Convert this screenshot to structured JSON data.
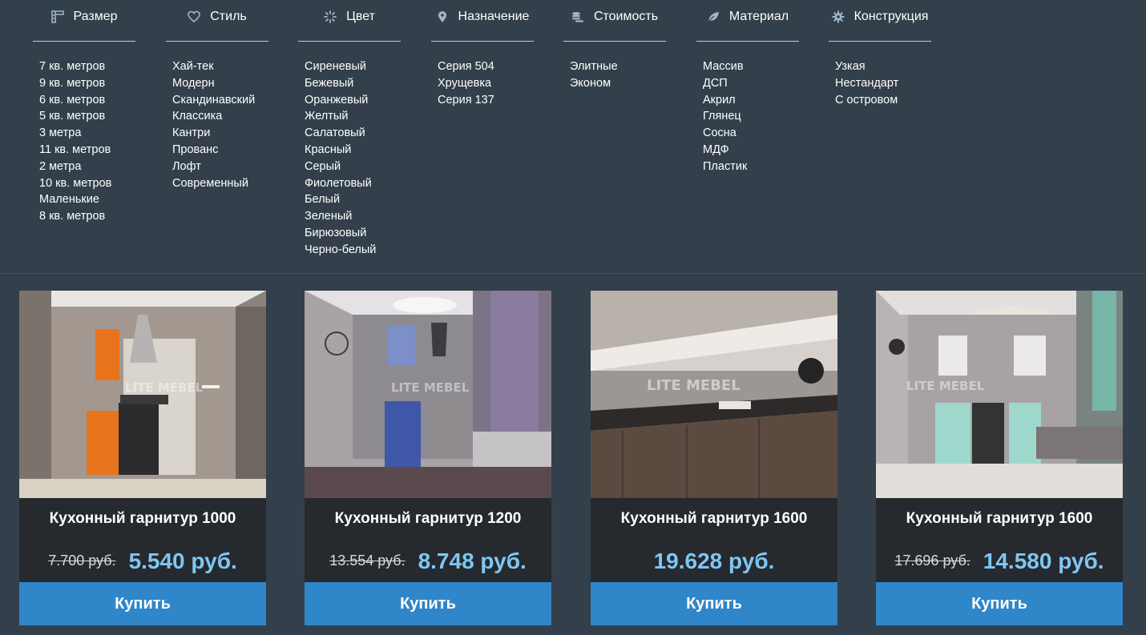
{
  "filters": [
    {
      "icon": "ruler-icon",
      "title": "Размер",
      "items": [
        "7 кв. метров",
        "9 кв. метров",
        "6 кв. метров",
        "5 кв. метров",
        "3 метра",
        "11 кв. метров",
        "2 метра",
        "10 кв. метров",
        "Маленькие",
        "8 кв. метров"
      ]
    },
    {
      "icon": "heart-icon",
      "title": "Стиль",
      "items": [
        "Хай-тек",
        "Модерн",
        "Скандинавский",
        "Классика",
        "Кантри",
        "Прованс",
        "Лофт",
        "Современный"
      ]
    },
    {
      "icon": "spinner-icon",
      "title": "Цвет",
      "items": [
        "Сиреневый",
        "Бежевый",
        "Оранжевый",
        "Желтый",
        "Салатовый",
        "Красный",
        "Серый",
        "Фиолетовый",
        "Белый",
        "Зеленый",
        "Бирюзовый",
        "Черно-белый"
      ]
    },
    {
      "icon": "map-marker-icon",
      "title": "Назначение",
      "items": [
        "Серия 504",
        "Хрущевка",
        "Серия 137"
      ]
    },
    {
      "icon": "coins-icon",
      "title": "Стоимость",
      "items": [
        "Элитные",
        "Эконом"
      ]
    },
    {
      "icon": "leaf-icon",
      "title": "Материал",
      "items": [
        "Массив",
        "ДСП",
        "Акрил",
        "Глянец",
        "Сосна",
        "МДФ",
        "Пластик"
      ]
    },
    {
      "icon": "gear-icon",
      "title": "Конструкция",
      "items": [
        "Узкая",
        "Нестандарт",
        "С островом"
      ]
    }
  ],
  "products": [
    {
      "title": "Кухонный гарнитур 1000",
      "old_price": "7.700 руб.",
      "price": "5.540 руб.",
      "buy_label": "Купить",
      "watermark": "LITE MEBEL"
    },
    {
      "title": "Кухонный гарнитур 1200",
      "old_price": "13.554 руб.",
      "price": "8.748 руб.",
      "buy_label": "Купить",
      "watermark": "LITE MEBEL"
    },
    {
      "title": "Кухонный гарнитур 1600",
      "old_price": "",
      "price": "19.628 руб.",
      "buy_label": "Купить",
      "watermark": "LITE MEBEL"
    },
    {
      "title": "Кухонный гарнитур 1600",
      "old_price": "17.696 руб.",
      "price": "14.580 руб.",
      "buy_label": "Купить",
      "watermark": "LITE MEBEL"
    }
  ],
  "colors": {
    "background": "#333f4a",
    "card": "#26292d",
    "price": "#7fc6f3",
    "buy_button": "#2f86c8"
  }
}
